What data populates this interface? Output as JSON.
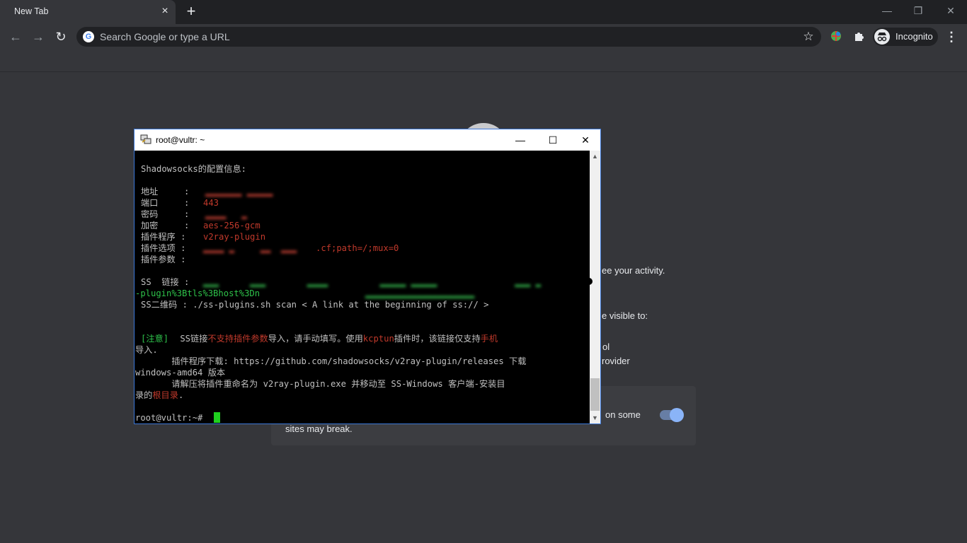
{
  "browser": {
    "tab_title": "New Tab",
    "tab_close": "×",
    "new_tab": "+",
    "window_controls": {
      "minimize": "—",
      "restore": "❐",
      "close": "✕"
    },
    "nav": {
      "back": "←",
      "forward": "→",
      "reload": "↻"
    },
    "omnibox_placeholder": "Search Google or type a URL",
    "google_g": "G",
    "star": "☆",
    "incognito_label": "Incognito",
    "menu": "⋮",
    "accent_color": "#8ab4f8"
  },
  "ntp": {
    "activity_fragment": "ee your activity.",
    "visible_fragment": "e visible to:",
    "school_fragment": "ol",
    "provider_fragment": "rovider",
    "some_fragment": "on some",
    "sites_break": "sites may break."
  },
  "terminal": {
    "title": "root@vultr: ~",
    "controls": {
      "minimize": "—",
      "maximize": "☐",
      "close": "✕"
    },
    "lines": {
      "header": "Shadowsocks的配置信息:",
      "addr_label": "地址     :",
      "addr_value": " ",
      "port_label": "端口     :",
      "port_value": "443",
      "pass_label": "密码     :",
      "pass_value": " ",
      "enc_label": "加密     :",
      "enc_value": "aes-256-gcm",
      "plugin_label": "插件程序 :",
      "plugin_value": "v2ray-plugin",
      "opts_label": "插件选项 :",
      "opts_value": ".cf;path=/;mux=0",
      "params_label": "插件参数 :",
      "ss_label": "SS  链接 :",
      "ss_cont": "-plugin%3Btls%3Bhost%3Dn",
      "qr_line": "SS二维码 : ./ss-plugins.sh scan < A link at the beginning of ss:// >",
      "note_tag": "[注意]",
      "note_a": " SS链接",
      "note_b": "不支持插件参数",
      "note_c": "导入，请手动填写。使用",
      "note_d": "kcptun",
      "note_e": "插件时，该链接仅支持",
      "note_f": "手机",
      "note_g": "导入.",
      "dl_line": "       插件程序下载: https://github.com/shadowsocks/v2ray-plugin/releases 下载",
      "dl_line2": "windows-amd64 版本",
      "unzip_line": "       请解压将插件重命名为 v2ray-plugin.exe 并移动至 SS-Windows 客户端-安装目",
      "unzip_a": "录的",
      "unzip_b": "根目录",
      "unzip_c": ".",
      "prompt": "root@vultr:~#"
    },
    "scroll": {
      "up": "▲",
      "down": "▼"
    }
  }
}
